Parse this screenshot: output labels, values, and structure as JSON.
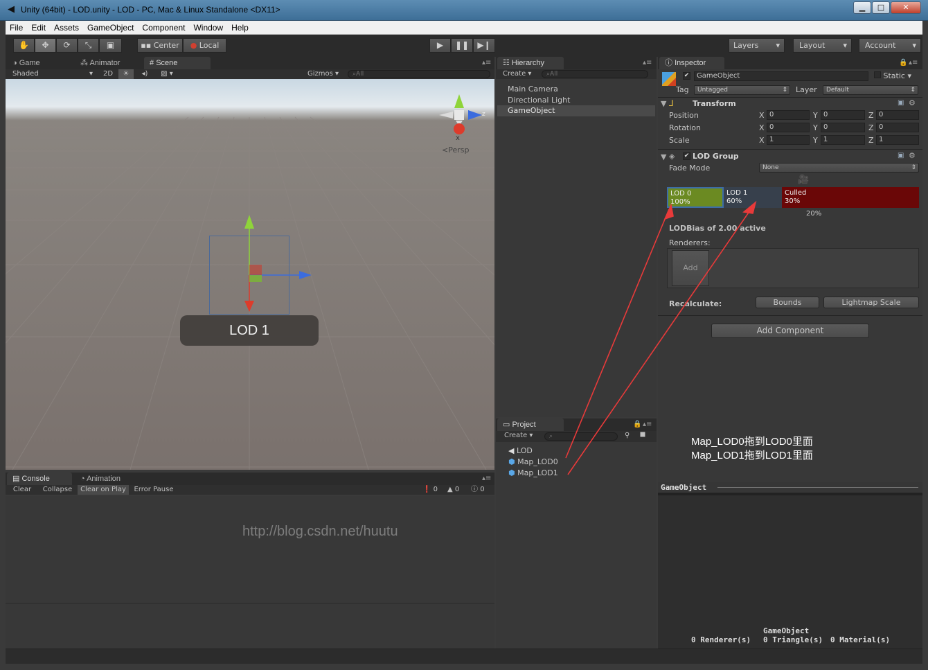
{
  "window": {
    "title": "Unity (64bit) - LOD.unity - LOD - PC, Mac & Linux Standalone <DX11>",
    "min": "▁",
    "max": "□",
    "close": "✕"
  },
  "menu": [
    "File",
    "Edit",
    "Assets",
    "GameObject",
    "Component",
    "Window",
    "Help"
  ],
  "toolbar": {
    "pivot": "Center",
    "space": "Local",
    "layers": "Layers",
    "layout": "Layout",
    "account": "Account"
  },
  "scene_tabs": {
    "game": "Game",
    "animator": "Animator",
    "scene": "Scene"
  },
  "scene_bar": {
    "shading": "Shaded",
    "mode2d": "2D",
    "gizmos": "Gizmos",
    "search": "All"
  },
  "scene": {
    "persp": "Persp",
    "axis_x": "x",
    "axis_z": "z",
    "lod_label": "LOD 1"
  },
  "hierarchy": {
    "tab": "Hierarchy",
    "create": "Create",
    "search": "All",
    "items": [
      "Main Camera",
      "Directional Light",
      "GameObject"
    ]
  },
  "project": {
    "tab": "Project",
    "create": "Create",
    "items": [
      "LOD",
      "Map_LOD0",
      "Map_LOD1"
    ]
  },
  "console": {
    "tab": "Console",
    "anim_tab": "Animation",
    "clear": "Clear",
    "collapse": "Collapse",
    "clear_on_play": "Clear on Play",
    "error_pause": "Error Pause",
    "info_count": "0",
    "warn_count": "0",
    "error_count": "0"
  },
  "watermark": "http://blog.csdn.net/huutu",
  "inspector": {
    "tab": "Inspector",
    "name": "GameObject",
    "static": "Static",
    "tag_label": "Tag",
    "tag": "Untagged",
    "layer_label": "Layer",
    "layer": "Default",
    "transform": {
      "title": "Transform",
      "rows": [
        {
          "label": "Position",
          "x": "0",
          "y": "0",
          "z": "0"
        },
        {
          "label": "Rotation",
          "x": "0",
          "y": "0",
          "z": "0"
        },
        {
          "label": "Scale",
          "x": "1",
          "y": "1",
          "z": "1"
        }
      ]
    },
    "lod_group": {
      "title": "LOD Group",
      "fade_label": "Fade Mode",
      "fade": "None",
      "levels": [
        {
          "name": "LOD 0",
          "pct": "100%",
          "color": "#6b8a22"
        },
        {
          "name": "LOD 1",
          "pct": "60%",
          "color": "#37404c"
        },
        {
          "name": "Culled",
          "pct": "30%",
          "color": "#6a0707"
        }
      ],
      "marker": "20%",
      "bias": "LODBias of 2.00 active",
      "renderers": "Renderers:",
      "add": "Add",
      "recalc": "Recalculate:",
      "bounds": "Bounds",
      "lightmap": "Lightmap Scale"
    },
    "add_component": "Add Component",
    "annotation": [
      "Map_LOD0拖到LOD0里面",
      "Map_LOD1拖到LOD1里面"
    ],
    "preview": {
      "title": "GameObject",
      "name": "GameObject",
      "renderers": "0 Renderer(s)",
      "triangles": "0 Triangle(s)",
      "materials": "0 Material(s)"
    }
  },
  "colors": {
    "accent_red": "#e83a3a",
    "lod0": "#6b8a22",
    "culled": "#6a0707"
  }
}
